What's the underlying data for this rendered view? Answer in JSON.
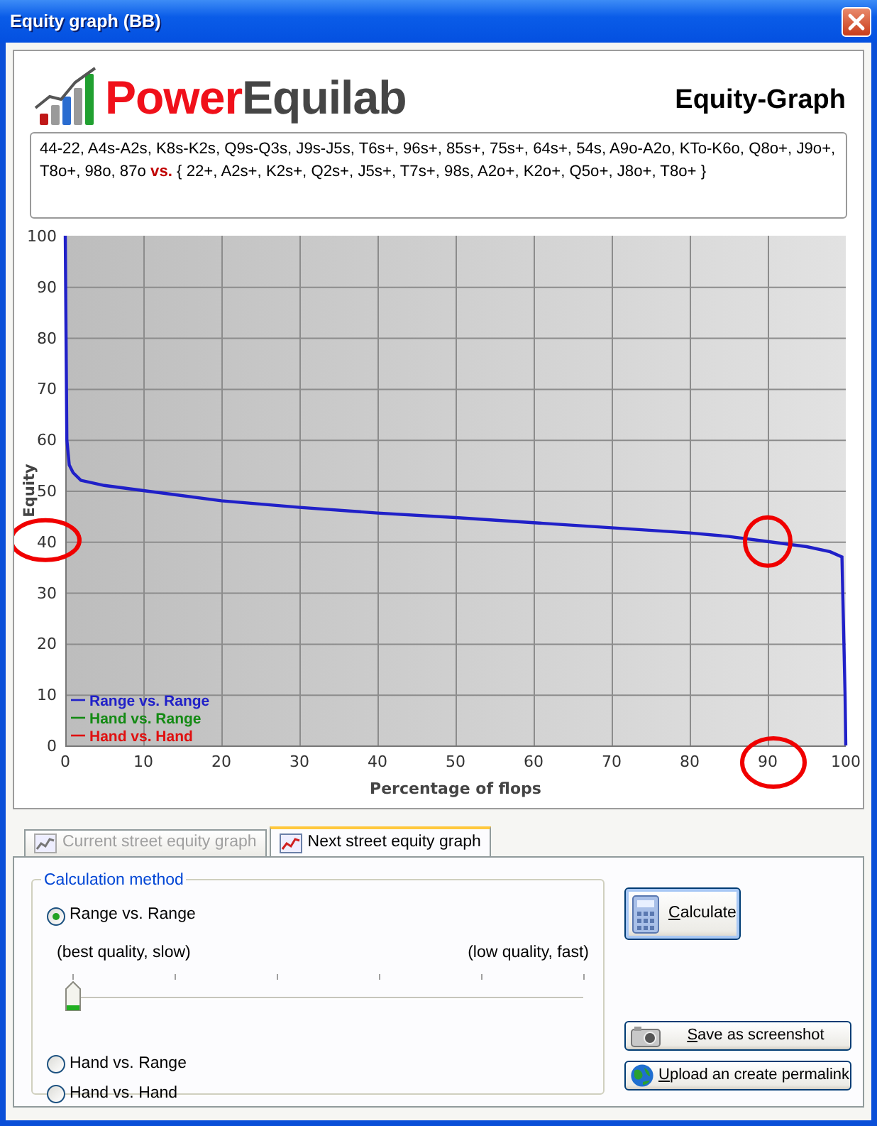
{
  "window": {
    "title": "Equity graph (BB)"
  },
  "header": {
    "logo_red": "Power",
    "logo_dark": "Equilab",
    "title": "Equity-Graph"
  },
  "ranges": {
    "hero": "44-22, A4s-A2s, K8s-K2s, Q9s-Q3s, J9s-J5s, T6s+, 96s+, 85s+, 75s+, 64s+, 54s, A9o-A2o, KTo-K6o, Q8o+, J9o+, T8o+, 98o, 87o",
    "vs": "vs.",
    "villain": "{ 22+, A2s+, K2s+, Q2s+, J5s+, T7s+, 98s, A2o+, K2o+, Q5o+, J8o+, T8o+ }"
  },
  "chart": {
    "chart_data": {
      "type": "line",
      "xlabel": "Percentage of flops",
      "ylabel": "Equity",
      "xlim": [
        0,
        100
      ],
      "ylim": [
        0,
        100
      ],
      "xticks": [
        0,
        10,
        20,
        30,
        40,
        50,
        60,
        70,
        80,
        90,
        100
      ],
      "yticks": [
        0,
        10,
        20,
        30,
        40,
        50,
        60,
        70,
        80,
        90,
        100
      ],
      "x": [
        0,
        0.2,
        0.5,
        1,
        2,
        5,
        10,
        20,
        30,
        40,
        50,
        60,
        70,
        80,
        85,
        90,
        95,
        98,
        99.5,
        99.9,
        100
      ],
      "grid": true,
      "series": [
        {
          "name": "Range vs. Range",
          "color": "#2020c8",
          "values": [
            100,
            60,
            55,
            53.5,
            52,
            51,
            50,
            48,
            46.7,
            45.6,
            44.7,
            43.7,
            42.7,
            41.7,
            41,
            40,
            39,
            38,
            37,
            10,
            0
          ]
        },
        {
          "name": "Hand vs. Range",
          "color": "#138a13",
          "values": [
            null,
            null,
            null,
            null,
            null,
            null,
            null,
            null,
            null,
            null,
            null,
            null,
            null,
            null,
            null,
            null,
            null,
            null,
            null,
            null,
            null
          ]
        },
        {
          "name": "Hand vs. Hand",
          "color": "#e01010",
          "values": [
            null,
            null,
            null,
            null,
            null,
            null,
            null,
            null,
            null,
            null,
            null,
            null,
            null,
            null,
            null,
            null,
            null,
            null,
            null,
            null,
            null
          ]
        }
      ]
    },
    "red_marks": [
      {
        "kind": "y-tick"
      },
      {
        "kind": "curve-point"
      },
      {
        "kind": "x-tick"
      }
    ]
  },
  "tabs": [
    {
      "label": "Current street equity graph",
      "selected": false,
      "disabled": true
    },
    {
      "label": "Next street equity graph",
      "selected": true,
      "disabled": false
    }
  ],
  "calculation": {
    "title": "Calculation method",
    "options": [
      {
        "label": "Range vs. Range",
        "selected": true
      },
      {
        "label": "Hand vs. Range",
        "selected": false
      },
      {
        "label": "Hand vs. Hand",
        "selected": false
      }
    ],
    "slider": {
      "left": "(best quality, slow)",
      "right": "(low quality, fast)",
      "level": 0
    }
  },
  "buttons": [
    {
      "label": "Calculate",
      "kind": "calculate"
    },
    {
      "label": "Save as screenshot",
      "kind": "screenshot"
    },
    {
      "label": "Upload an create permalink",
      "kind": "permalink"
    }
  ]
}
